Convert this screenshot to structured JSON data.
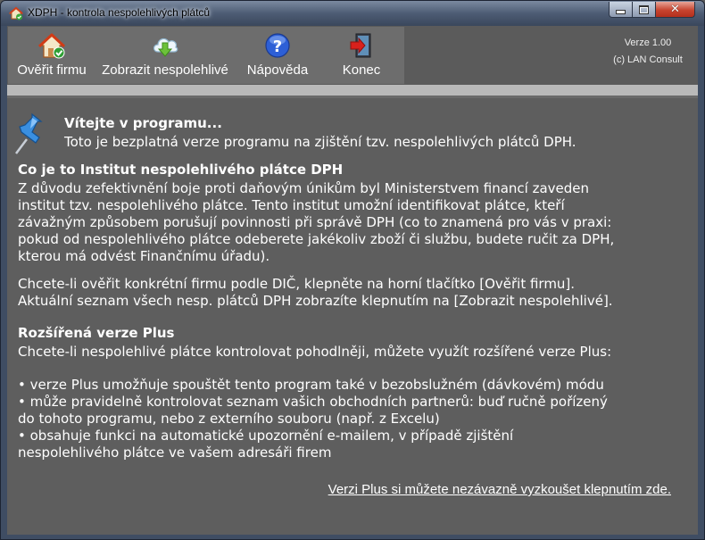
{
  "window": {
    "title": "XDPH - kontrola nespolehlivých plátců",
    "icons": {
      "app": "house-check-icon",
      "minimize": "minimize-icon",
      "maximize": "maximize-icon",
      "close": "close-icon"
    },
    "close_glyph": "✕"
  },
  "toolbar": {
    "buttons": [
      {
        "label": "Ověřit firmu",
        "icon": "house-check-icon"
      },
      {
        "label": "Zobrazit nespolehlivé",
        "icon": "cloud-download-icon"
      },
      {
        "label": "Nápověda",
        "icon": "help-icon"
      },
      {
        "label": "Konec",
        "icon": "exit-door-icon"
      }
    ],
    "version": "Verze 1.00",
    "copyright": "(c) LAN Consult"
  },
  "content": {
    "welcome_title": "Vítejte v programu...",
    "welcome_subtitle": "Toto je bezplatná verze programu na zjištění tzv. nespolehlivých plátců DPH.",
    "section1_title": "Co je to Institut nespolehlivého plátce DPH",
    "section1_lines": [
      "Z důvodu zefektivnění boje proti daňovým únikům byl Ministerstvem financí zaveden",
      "institut tzv. nespolehlivého plátce. Tento institut umožní identifikovat plátce, kteří",
      "závažným způsobem porušují povinnosti při správě DPH (co to znamená pro vás v praxi:",
      "pokud od nespolehlivého plátce odeberete jakékoliv zboží či službu, budete ručit za DPH,",
      "kterou má odvést Finančnímu úřadu)."
    ],
    "section2_lines": [
      "Chcete-li ověřit konkrétní firmu podle DIČ, klepněte na horní tlačítko [Ověřit firmu].",
      "Aktuální seznam všech nesp. plátců DPH zobrazíte klepnutím na [Zobrazit nespolehlivé]."
    ],
    "plus_title": "Rozšířená verze Plus",
    "plus_intro": "Chcete-li nespolehlivé plátce kontrolovat pohodlněji, můžete využít rozšířené verze Plus:",
    "plus_lines": [
      "• verze Plus umožňuje spouštět tento program také v bezobslužném (dávkovém) módu",
      "• může pravidelně kontrolovat seznam vašich obchodních partnerů: buď ručně pořízený",
      "do tohoto programu, nebo z externího souboru (např. z Excelu)",
      "• obsahuje funkci na automatické upozornění e-mailem, v případě zjištění",
      "nespolehlivého plátce ve vašem adresáři firem"
    ],
    "plus_link": "Verzi Plus si můžete nezávazně vyzkoušet klepnutím zde.",
    "pin_icon": "pushpin-icon"
  }
}
